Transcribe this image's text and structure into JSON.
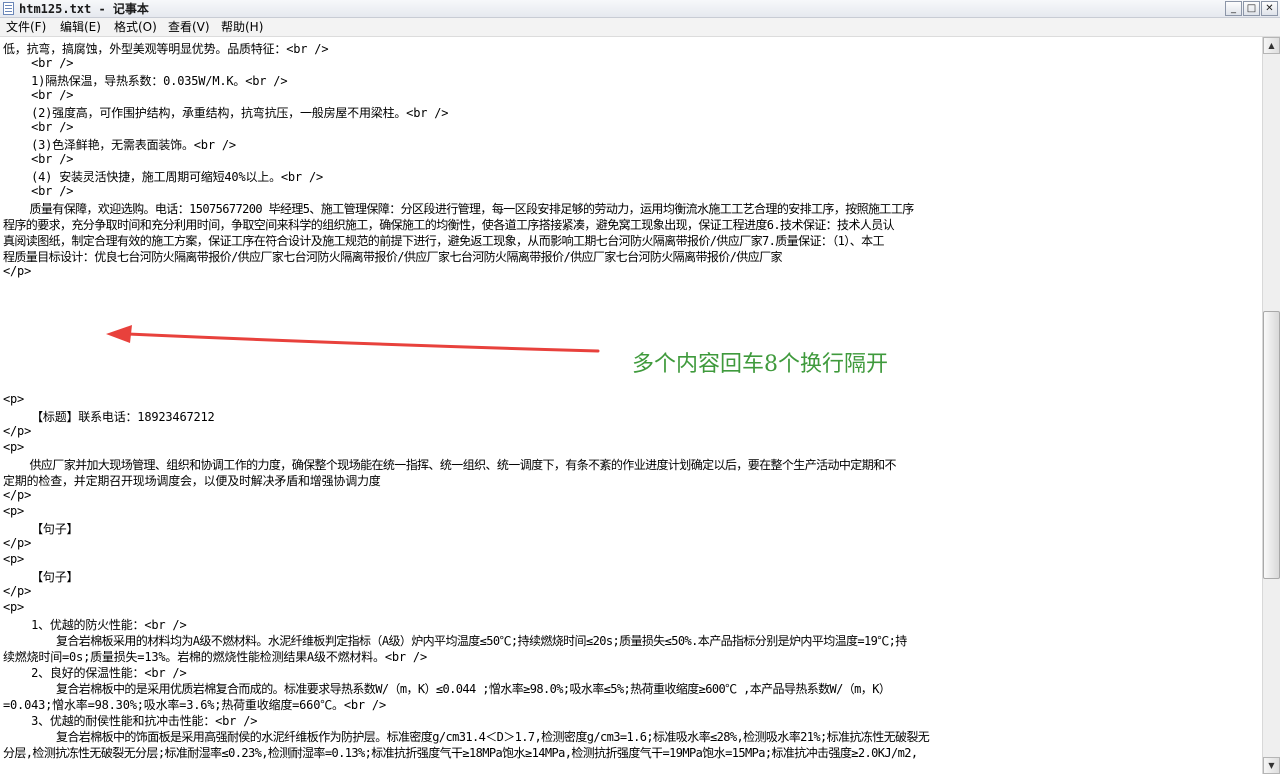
{
  "window": {
    "title": "htm125.txt - 记事本",
    "controls": {
      "minimize": "_",
      "maximize": "□",
      "close": "✕"
    }
  },
  "menu": {
    "items": [
      "文件(F)",
      "编辑(E)",
      "格式(O)",
      "查看(V)",
      "帮助(H)"
    ]
  },
  "editor": {
    "lines": [
      "低，抗弯，搞腐蚀，外型美观等明显优势。品质特征：<br />",
      "    <br />",
      "    1)隔热保温，导热系数：0.035W/M.K。<br />",
      "    <br />",
      "    (2)强度高，可作围护结构，承重结构，抗弯抗压，一般房屋不用梁柱。<br />",
      "    <br />",
      "    (3)色泽鲜艳，无需表面装饰。<br />",
      "    <br />",
      "    (4) 安装灵活快捷，施工周期可缩短40%以上。<br />",
      "    <br />",
      "    质量有保障，欢迎选购。电话：15075677200 毕经理5、施工管理保障：分区段进行管理，每一区段安排足够的劳动力，运用均衡流水施工工艺合理的安排工序，按照施工工序",
      "程序的要求，充分争取时间和充分利用时间，争取空间来科学的组织施工，确保施工的均衡性，使各道工序搭接紧凑，避免窝工现象出现，保证工程进度6.技术保证：技术人员认",
      "真阅读图纸，制定合理有效的施工方案，保证工序在符合设计及施工规范的前提下进行，避免返工现象，从而影响工期七台河防火隔离带报价/供应厂家7.质量保证：（1）、本工",
      "程质量目标设计：优良七台河防火隔离带报价/供应厂家七台河防火隔离带报价/供应厂家七台河防火隔离带报价/供应厂家七台河防火隔离带报价/供应厂家",
      "</p>",
      "",
      "",
      "",
      "",
      "",
      "",
      "",
      "<p>",
      "    【标题】联系电话：18923467212",
      "</p>",
      "<p>",
      "    供应厂家并加大现场管理、组织和协调工作的力度，确保整个现场能在统一指挥、统一组织、统一调度下，有条不紊的作业进度计划确定以后，要在整个生产活动中定期和不",
      "定期的检查，并定期召开现场调度会，以便及时解决矛盾和增强协调力度",
      "</p>",
      "<p>",
      "    【句子】",
      "</p>",
      "<p>",
      "    【句子】",
      "</p>",
      "<p>",
      "    1、优越的防火性能：<br />",
      "        复合岩棉板采用的材料均为A级不燃材料。水泥纤维板判定指标（A级）炉内平均温度≤50℃;持续燃烧时间≤20s;质量损失≤50%.本产品指标分别是炉内平均温度=19℃;持",
      "续燃烧时间=0s;质量损失=13%。岩棉的燃烧性能检测结果A级不燃材料。<br />",
      "    2、良好的保温性能：<br />",
      "        复合岩棉板中的是采用优质岩棉复合而成的。标准要求导热系数W/（m，K）≤0.044 ;憎水率≥98.0%;吸水率≤5%;热荷重收缩度≥600℃ ,本产品导热系数W/（m，K）",
      "=0.043;憎水率=98.30%;吸水率=3.6%;热荷重收缩度=660℃。<br />",
      "    3、优越的耐侯性能和抗冲击性能：<br />",
      "        复合岩棉板中的饰面板是采用高强耐侯的水泥纤维板作为防护层。标准密度g/cm31.4＜D＞1.7,检测密度g/cm3=1.6;标准吸水率≤28%,检测吸水率21%;标准抗冻性无破裂无",
      "分层,检测抗冻性无破裂无分层;标准耐湿率≤0.23%,检测耐湿率=0.13%;标准抗折强度气干≥18MPa饱水≥14MPa,检测抗折强度气干=19MPa饱水=15MPa;标准抗冲击强度≥2.0KJ/m2,"
    ]
  },
  "annotation": {
    "text": "多个内容回车8个换行隔开",
    "color": "#3f9a3c",
    "arrow_color": "#e8413c"
  },
  "scrollbar": {
    "up": "▲",
    "down": "▼"
  }
}
